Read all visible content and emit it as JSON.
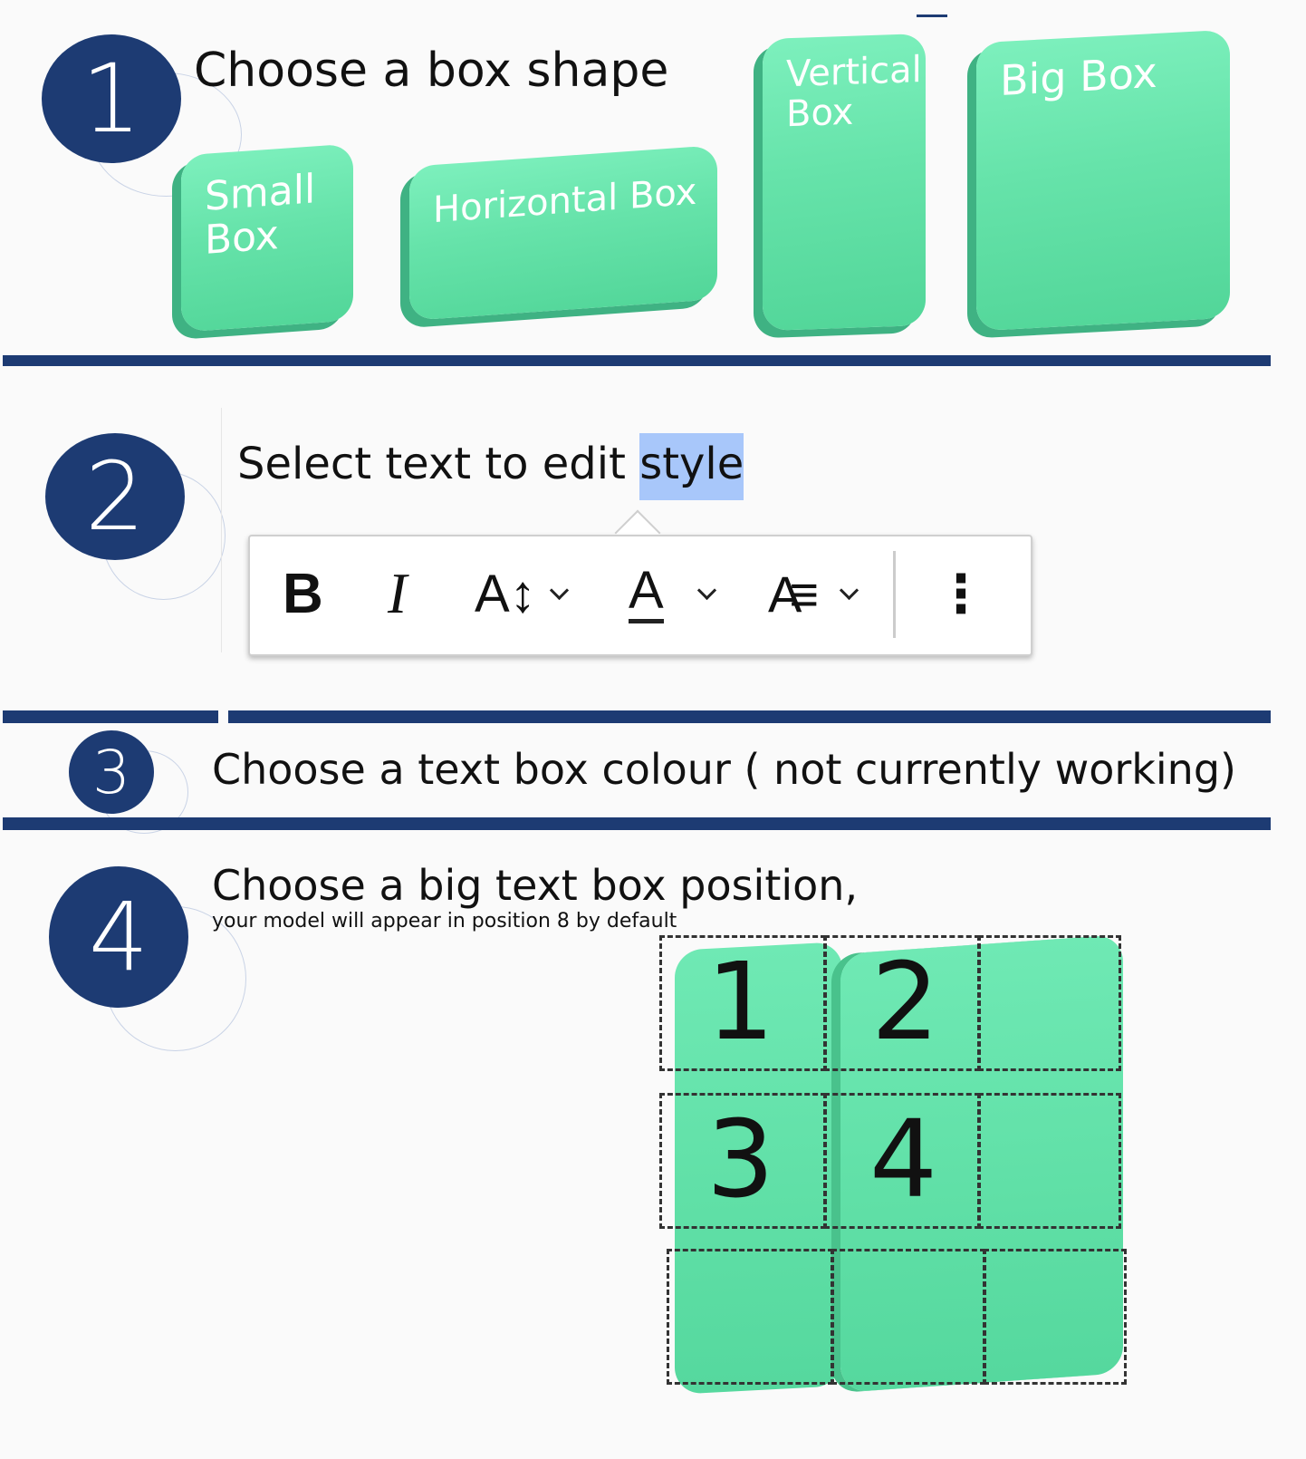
{
  "step1": {
    "number": "1",
    "heading": "Choose a box shape",
    "shapes": [
      {
        "label_line1": "Small",
        "label_line2": "Box"
      },
      {
        "label": "Horizontal Box"
      },
      {
        "label_line1": "Vertical",
        "label_line2": "Box"
      },
      {
        "label": "Big Box"
      }
    ]
  },
  "step2": {
    "number": "2",
    "heading_plain": "Select text to edit ",
    "heading_selected": "style",
    "toolbar": {
      "bold": "B",
      "italic": "I",
      "font_size": "A↕",
      "font_color": "A",
      "text_effects": "A≡",
      "more": "⋮"
    }
  },
  "step3": {
    "number": "3",
    "heading": "Choose a text box colour ( not currently working)"
  },
  "step4": {
    "number": "4",
    "heading": "Choose a big text box position,",
    "subheading": "your model will appear in position 8 by default",
    "positions": [
      "1",
      "2",
      "3",
      "4"
    ]
  },
  "colors": {
    "brand_navy": "#1d3b73",
    "box_green": "#66e3aa",
    "selection_blue": "#a8c7fa"
  }
}
